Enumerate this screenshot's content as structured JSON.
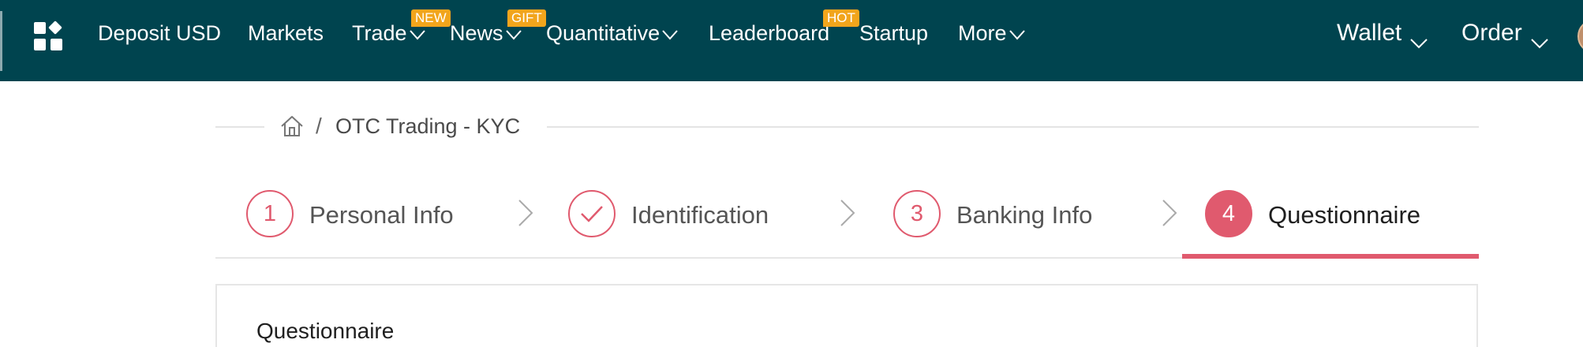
{
  "colors": {
    "navbar_bg": "#00444f",
    "accent": "#e05a6e",
    "badge": "#f2a51c"
  },
  "nav": {
    "apps_icon": "grid-apps-icon",
    "items": [
      {
        "label": "Deposit USD",
        "has_dropdown": false
      },
      {
        "label": "Markets",
        "has_dropdown": false
      },
      {
        "label": "Trade",
        "has_dropdown": true,
        "badge": "NEW"
      },
      {
        "label": "News",
        "has_dropdown": true,
        "badge": "GIFT"
      },
      {
        "label": "Quantitative",
        "has_dropdown": true
      },
      {
        "label": "Leaderboard",
        "has_dropdown": false,
        "badge": "HOT"
      },
      {
        "label": "Startup",
        "has_dropdown": false
      },
      {
        "label": "More",
        "has_dropdown": true
      }
    ],
    "right": [
      {
        "label": "Wallet",
        "has_dropdown": true
      },
      {
        "label": "Order",
        "has_dropdown": true
      }
    ]
  },
  "breadcrumb": {
    "home_icon": "home-icon",
    "separator": "/",
    "current": "OTC Trading - KYC"
  },
  "stepper": {
    "steps": [
      {
        "marker": "1",
        "label": "Personal Info",
        "state": "pending"
      },
      {
        "marker": "check-icon",
        "label": "Identification",
        "state": "done"
      },
      {
        "marker": "3",
        "label": "Banking Info",
        "state": "pending"
      },
      {
        "marker": "4",
        "label": "Questionnaire",
        "state": "active"
      }
    ]
  },
  "card": {
    "title": "Questionnaire"
  }
}
